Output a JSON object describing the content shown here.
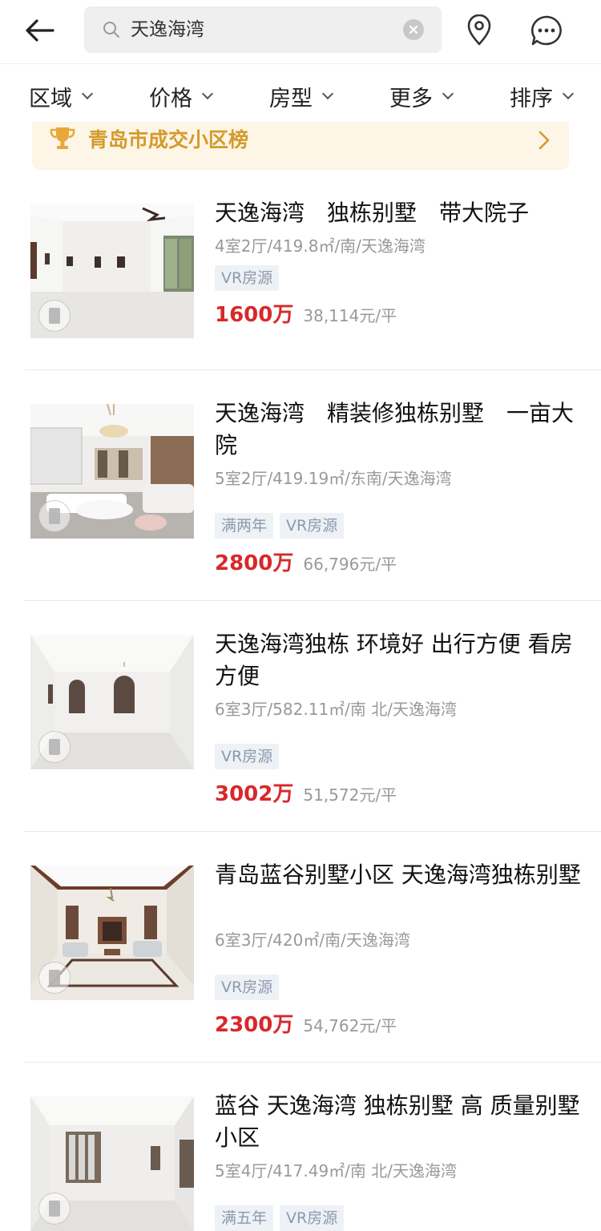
{
  "search": {
    "query": "天逸海湾"
  },
  "filters": [
    {
      "label": "区域"
    },
    {
      "label": "价格"
    },
    {
      "label": "房型"
    },
    {
      "label": "更多"
    },
    {
      "label": "排序"
    }
  ],
  "banner": {
    "text": "青岛市成交小区榜"
  },
  "listings": [
    {
      "title": "天逸海湾　独栋别墅　带大院子",
      "meta": "4室2厅/419.8㎡/南/天逸海湾",
      "tags": [
        "VR房源"
      ],
      "price": "1600万",
      "unit_price": "38,114元/平"
    },
    {
      "title": "天逸海湾　精装修独栋别墅　一亩大院",
      "meta": "5室2厅/419.19㎡/东南/天逸海湾",
      "tags": [
        "满两年",
        "VR房源"
      ],
      "price": "2800万",
      "unit_price": "66,796元/平"
    },
    {
      "title": "天逸海湾独栋 环境好 出行方便 看房方便",
      "meta": "6室3厅/582.11㎡/南 北/天逸海湾",
      "tags": [
        "VR房源"
      ],
      "price": "3002万",
      "unit_price": "51,572元/平"
    },
    {
      "title": "青岛蓝谷别墅小区 天逸海湾独栋别墅",
      "meta": "6室3厅/420㎡/南/天逸海湾",
      "tags": [
        "VR房源"
      ],
      "price": "2300万",
      "unit_price": "54,762元/平"
    },
    {
      "title": "蓝谷 天逸海湾 独栋别墅 高 质量别墅小区",
      "meta": "5室4厅/417.49㎡/南 北/天逸海湾",
      "tags": [
        "满五年",
        "VR房源"
      ]
    }
  ]
}
